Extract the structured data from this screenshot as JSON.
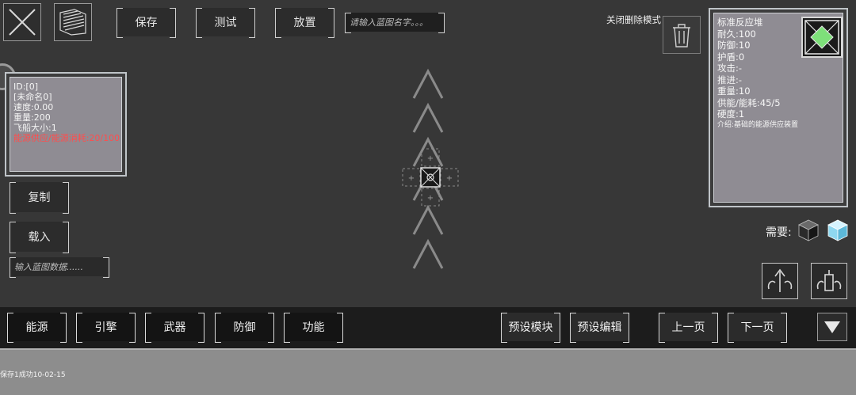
{
  "toolbar": {
    "save_label": "保存",
    "test_label": "测试",
    "place_label": "放置",
    "name_placeholder": "请输入蓝图名字。。。"
  },
  "delete_mode_label": "关闭删除模式",
  "ship_info": {
    "id": "ID:[0]",
    "name": "[未命名0]",
    "speed": "速度:0.00",
    "weight": "重量:200",
    "ship_size": "飞船大小:1",
    "energy": "能源供应/能源消耗:20/100"
  },
  "left_actions": {
    "copy_label": "复制",
    "load_label": "载入",
    "data_placeholder": "输入蓝图数据......"
  },
  "module_info": {
    "name": "标准反应堆",
    "durability": "耐久:100",
    "defense": "防御:10",
    "shield": "护盾:0",
    "attack": "攻击:-",
    "thrust": "推进:-",
    "weight": "重量:10",
    "power": "供能/能耗:45/5",
    "hardness": "硬度:1",
    "description": "介绍:基础的能源供应装置"
  },
  "needs_label": "需要:",
  "categories": [
    "能源",
    "引擎",
    "武器",
    "防御",
    "功能"
  ],
  "preset": {
    "module_label": "预设模块",
    "edit_label": "预设编辑"
  },
  "paging": {
    "prev_label": "上一页",
    "next_label": "下一页"
  },
  "status_text": "保存1成功10-02-15",
  "colors": {
    "energy_warning": "#ff4d4d",
    "reactor_core": "#7ee07a",
    "crystal": "#8fd8f0"
  }
}
